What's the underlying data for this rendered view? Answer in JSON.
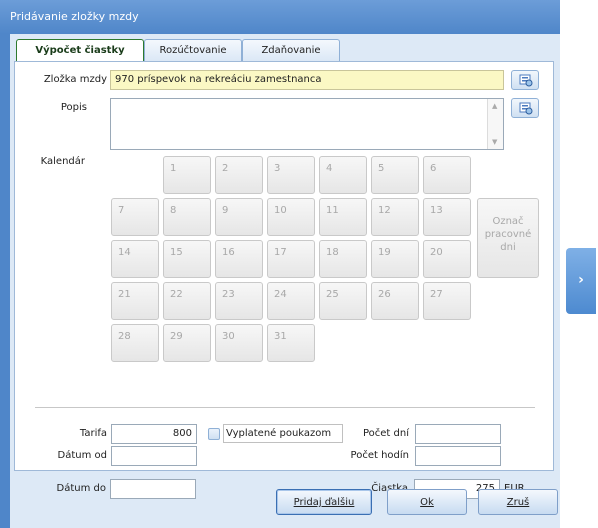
{
  "window": {
    "title": "Pridávanie zložky mzdy"
  },
  "tabs": [
    {
      "label": "Výpočet čiastky",
      "active": true
    },
    {
      "label": "Rozúčtovanie",
      "active": false
    },
    {
      "label": "Zdaňovanie",
      "active": false
    }
  ],
  "form": {
    "component_label": "Zložka mzdy",
    "component_value": "970  príspevok na rekreáciu zamestnanca",
    "description_label": "Popis",
    "description_value": "",
    "calendar_label": "Kalendár",
    "calendar_days": [
      "1",
      "2",
      "3",
      "4",
      "5",
      "6",
      "7",
      "8",
      "9",
      "10",
      "11",
      "12",
      "13",
      "14",
      "15",
      "16",
      "17",
      "18",
      "19",
      "20",
      "21",
      "22",
      "23",
      "24",
      "25",
      "26",
      "27",
      "28",
      "29",
      "30",
      "31"
    ],
    "mark_workdays_label": "Označ pracovné dni",
    "tariff_label": "Tarifa",
    "tariff_value": "800",
    "vouchers_label": "Vyplatené poukazom",
    "vouchers_checked": false,
    "date_from_label": "Dátum od",
    "date_from_value": "",
    "date_to_label": "Dátum do",
    "date_to_value": "",
    "days_count_label": "Počet dní",
    "days_count_value": "",
    "hours_count_label": "Počet hodín",
    "hours_count_value": "",
    "amount_label": "Čiastka",
    "amount_value": "275",
    "currency": "EUR"
  },
  "buttons": {
    "add_next": "Pridaj ďalšiu",
    "ok": "Ok",
    "cancel": "Zruš"
  },
  "icons": {
    "lookup": "lookup-icon",
    "side_expand": "chevron-right-icon"
  }
}
